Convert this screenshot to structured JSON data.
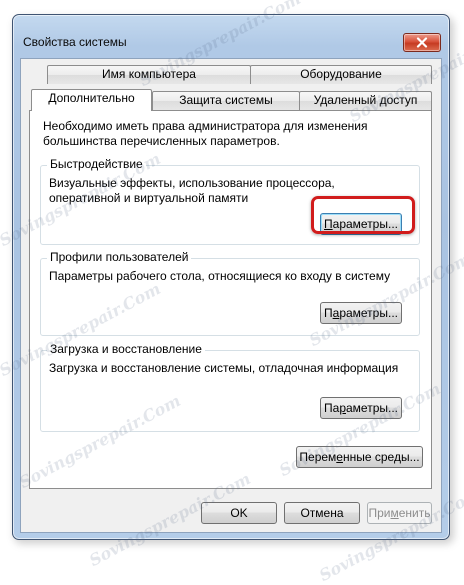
{
  "window": {
    "title": "Свойства системы",
    "close_label": "Close"
  },
  "tabs": {
    "row_back": [
      "Имя компьютера",
      "Оборудование"
    ],
    "row_front": [
      "Дополнительно",
      "Защита системы",
      "Удаленный доступ"
    ],
    "active": "Дополнительно"
  },
  "panel": {
    "intro": "Необходимо иметь права администратора для изменения большинства перечисленных параметров.",
    "performance": {
      "title": "Быстродействие",
      "description": "Визуальные эффекты, использование процессора, оперативной и виртуальной памяти",
      "button_prefix": "",
      "button_mnemonic": "П",
      "button_rest": "араметры..."
    },
    "profiles": {
      "title": "Профили пользователей",
      "description": "Параметры рабочего стола, относящиеся ко входу в систему",
      "button_prefix": "П",
      "button_mnemonic": "а",
      "button_rest": "раметры..."
    },
    "startup": {
      "title": "Загрузка и восстановление",
      "description": "Загрузка и восстановление системы, отладочная информация",
      "button_prefix": "Па",
      "button_mnemonic": "р",
      "button_rest": "аметры..."
    },
    "env_button": {
      "prefix": "Перем",
      "mnemonic": "е",
      "rest": "нные среды..."
    }
  },
  "footer": {
    "ok": "OK",
    "cancel": "Отмена",
    "apply_prefix": "При",
    "apply_mnemonic": "м",
    "apply_rest": "енить"
  },
  "watermark": "Sovingsprepair.Com",
  "colors": {
    "highlight": "#d11c1c",
    "titlebar": "#b0c9e6",
    "close_button": "#c63b22"
  }
}
